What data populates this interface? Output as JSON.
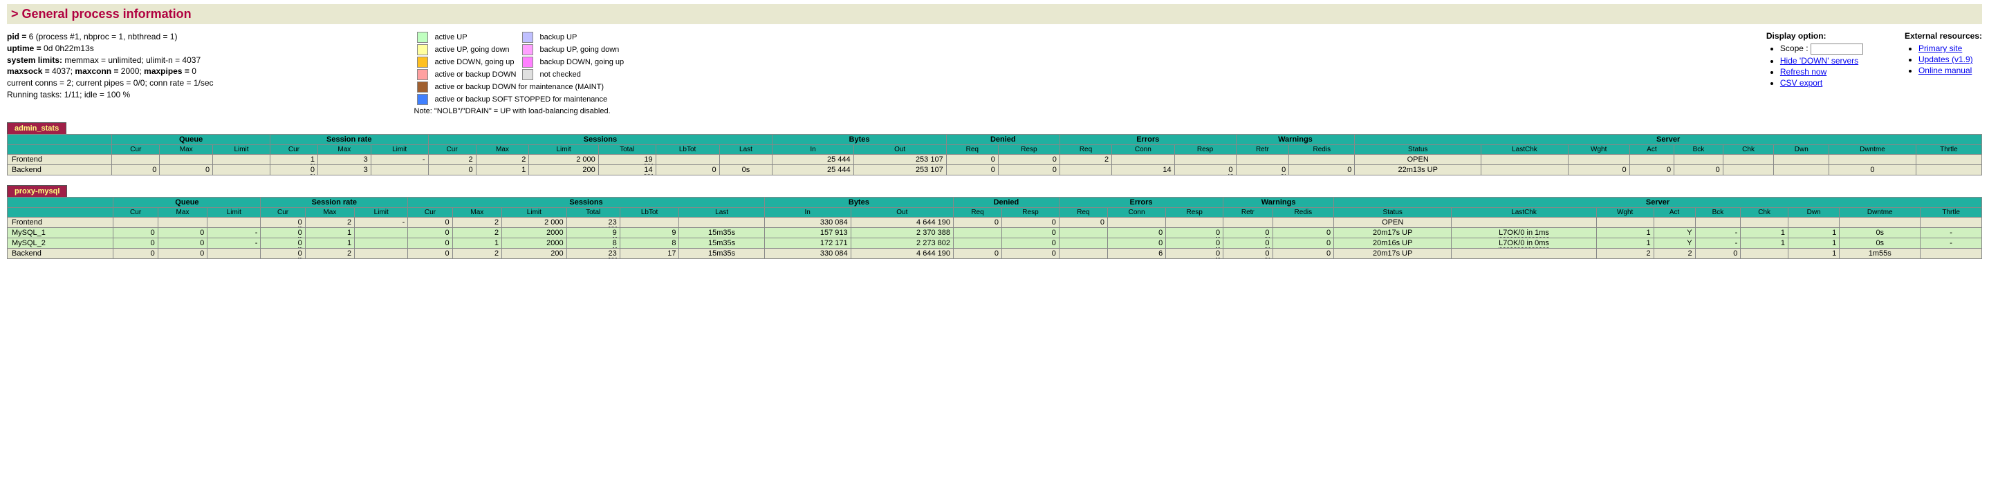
{
  "title": "> General process information",
  "info": {
    "pid_label": "pid = ",
    "pid_val": "6 (process #1, nbproc = 1, nbthread = 1)",
    "uptime_label": "uptime = ",
    "uptime_val": "0d 0h22m13s",
    "limits_label": "system limits:",
    "limits_val": " memmax = unlimited; ulimit-n = 4037",
    "maxsock_label": "maxsock = ",
    "maxsock_val": "4037; ",
    "maxconn_label": "maxconn = ",
    "maxconn_val": "2000; ",
    "maxpipes_label": "maxpipes = ",
    "maxpipes_val": "0",
    "current_line": "current conns = 2; current pipes = 0/0; conn rate = 1/sec",
    "running_line": "Running tasks: 1/11; idle = 100 %"
  },
  "legend": {
    "rows": [
      [
        "#c0ffc0",
        "active UP",
        "#c0c0ff",
        "backup UP"
      ],
      [
        "#ffffa0",
        "active UP, going down",
        "#ffa0ff",
        "backup UP, going down"
      ],
      [
        "#ffc020",
        "active DOWN, going up",
        "#ff80ff",
        "backup DOWN, going up"
      ],
      [
        "#ffa0a0",
        "active or backup DOWN",
        "#e0e0e0",
        "not checked"
      ],
      [
        "#a06030",
        "active or backup DOWN for maintenance (MAINT)",
        "",
        ""
      ],
      [
        "#4080ff",
        "active or backup SOFT STOPPED for maintenance",
        "",
        ""
      ]
    ],
    "note": "Note: \"NOLB\"/\"DRAIN\" = UP with load-balancing disabled."
  },
  "display": {
    "heading": "Display option:",
    "scope_label": "Scope :",
    "hide_down": "Hide 'DOWN' servers",
    "refresh": "Refresh now",
    "csv": "CSV export"
  },
  "external": {
    "heading": "External resources:",
    "primary": "Primary site",
    "updates": "Updates (v1.9)",
    "manual": "Online manual"
  },
  "headers": {
    "groups": [
      "",
      "Queue",
      "Session rate",
      "Sessions",
      "Bytes",
      "Denied",
      "Errors",
      "Warnings",
      "Server"
    ],
    "cols": [
      "",
      "Cur",
      "Max",
      "Limit",
      "Cur",
      "Max",
      "Limit",
      "Cur",
      "Max",
      "Limit",
      "Total",
      "LbTot",
      "Last",
      "In",
      "Out",
      "Req",
      "Resp",
      "Req",
      "Conn",
      "Resp",
      "Retr",
      "Redis",
      "Status",
      "LastChk",
      "Wght",
      "Act",
      "Bck",
      "Chk",
      "Dwn",
      "Dwntme",
      "Thrtle"
    ]
  },
  "proxies": [
    {
      "name": "admin_stats",
      "rows": [
        {
          "cls": "frontend",
          "name": "Frontend",
          "q_cur": "",
          "q_max": "",
          "q_lim": "",
          "sr_cur": "1",
          "sr_max": "3",
          "sr_lim": "-",
          "s_cur": "2",
          "s_max": "2",
          "s_lim": "2 000",
          "s_tot": "19",
          "lbtot": "",
          "last": "",
          "b_in": "25 444",
          "b_out": "253 107",
          "d_req": "0",
          "d_resp": "0",
          "e_req": "2",
          "e_conn": "",
          "e_resp": "",
          "w_retr": "",
          "w_redis": "",
          "status": "OPEN",
          "lastchk": "",
          "wght": "",
          "act": "",
          "bck": "",
          "chk": "",
          "dwn": "",
          "dwntme": "",
          "thrtle": ""
        },
        {
          "cls": "backend",
          "name": "Backend",
          "q_cur": "0",
          "q_max": "0",
          "q_lim": "",
          "sr_cur": "0",
          "sr_max": "3",
          "sr_lim": "",
          "s_cur": "0",
          "s_max": "1",
          "s_lim": "200",
          "s_tot": "14",
          "lbtot": "0",
          "last": "0s",
          "b_in": "25 444",
          "b_out": "253 107",
          "d_req": "0",
          "d_resp": "0",
          "e_req": "",
          "e_conn": "14",
          "e_resp": "0",
          "w_retr": "0",
          "w_redis": "0",
          "status": "22m13s UP",
          "lastchk": "",
          "wght": "0",
          "act": "0",
          "bck": "0",
          "chk": "",
          "dwn": "",
          "dwntme": "0",
          "thrtle": ""
        }
      ]
    },
    {
      "name": "proxy-mysql",
      "rows": [
        {
          "cls": "frontend",
          "name": "Frontend",
          "q_cur": "",
          "q_max": "",
          "q_lim": "",
          "sr_cur": "0",
          "sr_max": "2",
          "sr_lim": "-",
          "s_cur": "0",
          "s_max": "2",
          "s_lim": "2 000",
          "s_tot": "23",
          "lbtot": "",
          "last": "",
          "b_in": "330 084",
          "b_out": "4 644 190",
          "d_req": "0",
          "d_resp": "0",
          "e_req": "0",
          "e_conn": "",
          "e_resp": "",
          "w_retr": "",
          "w_redis": "",
          "status": "OPEN",
          "lastchk": "",
          "wght": "",
          "act": "",
          "bck": "",
          "chk": "",
          "dwn": "",
          "dwntme": "",
          "thrtle": ""
        },
        {
          "cls": "server",
          "name": "MySQL_1",
          "q_cur": "0",
          "q_max": "0",
          "q_lim": "-",
          "sr_cur": "0",
          "sr_max": "1",
          "sr_lim": "",
          "s_cur": "0",
          "s_max": "2",
          "s_lim": "2000",
          "s_tot": "9",
          "lbtot": "9",
          "last": "15m35s",
          "b_in": "157 913",
          "b_out": "2 370 388",
          "d_req": "",
          "d_resp": "0",
          "e_req": "",
          "e_conn": "0",
          "e_resp": "0",
          "w_retr": "0",
          "w_redis": "0",
          "status": "20m17s UP",
          "lastchk": "L7OK/0 in 1ms",
          "wght": "1",
          "act": "Y",
          "bck": "-",
          "chk": "1",
          "dwn": "1",
          "dwntme": "0s",
          "thrtle": "-"
        },
        {
          "cls": "server",
          "name": "MySQL_2",
          "q_cur": "0",
          "q_max": "0",
          "q_lim": "-",
          "sr_cur": "0",
          "sr_max": "1",
          "sr_lim": "",
          "s_cur": "0",
          "s_max": "1",
          "s_lim": "2000",
          "s_tot": "8",
          "lbtot": "8",
          "last": "15m35s",
          "b_in": "172 171",
          "b_out": "2 273 802",
          "d_req": "",
          "d_resp": "0",
          "e_req": "",
          "e_conn": "0",
          "e_resp": "0",
          "w_retr": "0",
          "w_redis": "0",
          "status": "20m16s UP",
          "lastchk": "L7OK/0 in 0ms",
          "wght": "1",
          "act": "Y",
          "bck": "-",
          "chk": "1",
          "dwn": "1",
          "dwntme": "0s",
          "thrtle": "-"
        },
        {
          "cls": "backend",
          "name": "Backend",
          "q_cur": "0",
          "q_max": "0",
          "q_lim": "",
          "sr_cur": "0",
          "sr_max": "2",
          "sr_lim": "",
          "s_cur": "0",
          "s_max": "2",
          "s_lim": "200",
          "s_tot": "23",
          "lbtot": "17",
          "last": "15m35s",
          "b_in": "330 084",
          "b_out": "4 644 190",
          "d_req": "0",
          "d_resp": "0",
          "e_req": "",
          "e_conn": "6",
          "e_resp": "0",
          "w_retr": "0",
          "w_redis": "0",
          "status": "20m17s UP",
          "lastchk": "",
          "wght": "2",
          "act": "2",
          "bck": "0",
          "chk": "",
          "dwn": "1",
          "dwntme": "1m55s",
          "thrtle": ""
        }
      ]
    }
  ]
}
